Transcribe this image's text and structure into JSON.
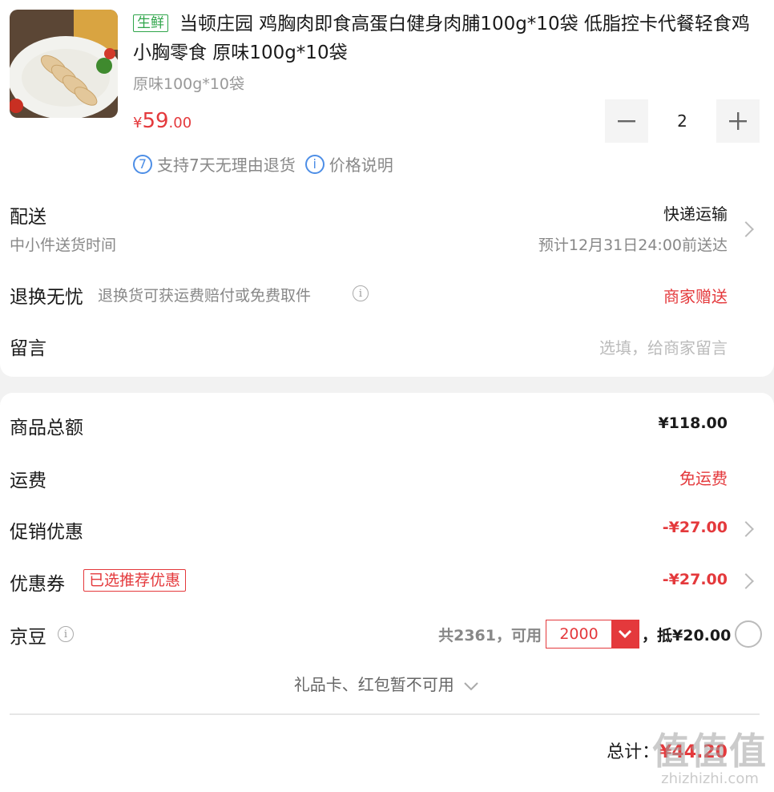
{
  "product": {
    "tag": "生鲜",
    "title": "当顿庄园 鸡胸肉即食高蛋白健身肉脯100g*10袋 低脂控卡代餐轻食鸡小胸零食 原味100g*10袋",
    "spec": "原味100g*10袋",
    "price_symbol": "¥",
    "price_int": "59",
    "price_dec": ".00",
    "quantity": "2",
    "services": [
      {
        "icon": "7",
        "text": "支持7天无理由退货"
      },
      {
        "icon": "i",
        "text": "价格说明"
      }
    ]
  },
  "delivery": {
    "label": "配送",
    "sub": "中小件送货时间",
    "method": "快递运输",
    "eta": "预计12月31日24:00前送达"
  },
  "returns": {
    "label": "退换无忧",
    "desc": "退换货可获运费赔付或免费取件",
    "value": "商家赠送"
  },
  "message": {
    "label": "留言",
    "placeholder": "选填，给商家留言"
  },
  "summary": {
    "goods_label": "商品总额",
    "goods_value": "¥118.00",
    "shipping_label": "运费",
    "shipping_value": "免运费",
    "promo_label": "促销优惠",
    "promo_value": "-¥27.00",
    "coupon_label": "优惠券",
    "coupon_badge": "已选推荐优惠",
    "coupon_value": "-¥27.00",
    "beans_label": "京豆",
    "beans_total_text": "共2361，可用",
    "beans_selected": "2000",
    "beans_deduct_text": "，抵¥20.00",
    "giftcard_text": "礼品卡、红包暂不可用",
    "total_label": "总计：",
    "total_value": "¥44.20"
  },
  "watermark": {
    "big": "值值值",
    "small": "zhizhizhi.com"
  },
  "colors": {
    "accent_red": "#e4393c",
    "fresh_green": "#2fa54a",
    "info_blue": "#4d8ee6"
  }
}
